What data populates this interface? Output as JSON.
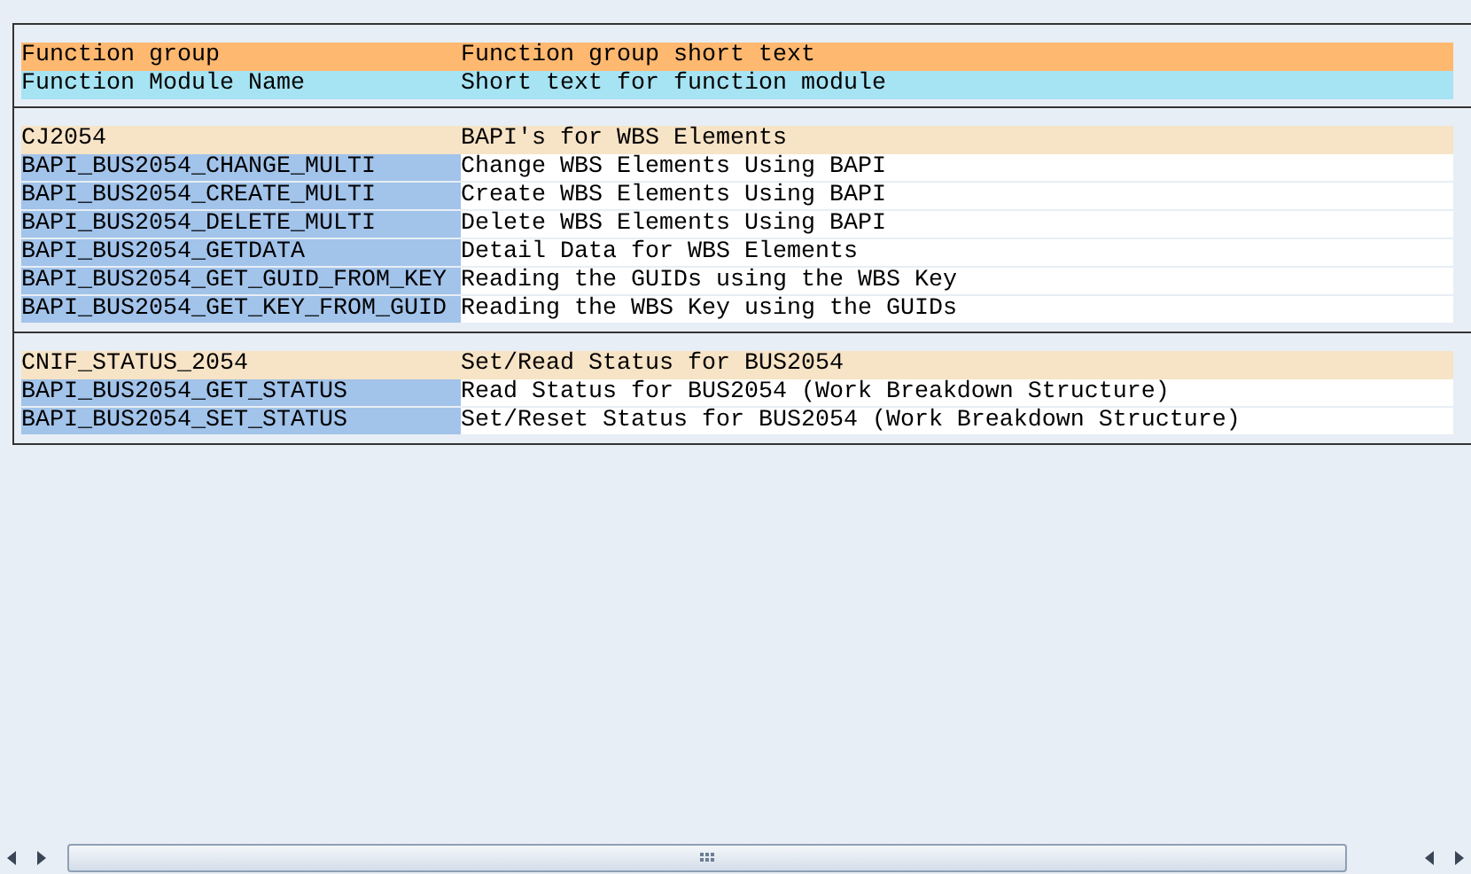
{
  "header": [
    {
      "kind": "group",
      "name": "Function group",
      "text": "Function group short text"
    },
    {
      "kind": "module",
      "name": "Function Module Name",
      "text": "Short text for function module"
    }
  ],
  "groups": [
    {
      "name": "CJ2054",
      "text": "BAPI's for WBS Elements",
      "modules": [
        {
          "name": "BAPI_BUS2054_CHANGE_MULTI",
          "text": "Change WBS Elements Using BAPI"
        },
        {
          "name": "BAPI_BUS2054_CREATE_MULTI",
          "text": "Create WBS Elements Using BAPI"
        },
        {
          "name": "BAPI_BUS2054_DELETE_MULTI",
          "text": "Delete WBS Elements Using BAPI"
        },
        {
          "name": "BAPI_BUS2054_GETDATA",
          "text": "Detail Data for WBS Elements"
        },
        {
          "name": "BAPI_BUS2054_GET_GUID_FROM_KEY",
          "text": "Reading the GUIDs using the WBS Key"
        },
        {
          "name": "BAPI_BUS2054_GET_KEY_FROM_GUID",
          "text": "Reading the WBS Key using the GUIDs"
        }
      ]
    },
    {
      "name": "CNIF_STATUS_2054",
      "text": "Set/Read Status for BUS2054",
      "modules": [
        {
          "name": "BAPI_BUS2054_GET_STATUS",
          "text": "Read Status for BUS2054 (Work Breakdown Structure)"
        },
        {
          "name": "BAPI_BUS2054_SET_STATUS",
          "text": "Set/Reset Status for BUS2054 (Work Breakdown Structure)"
        }
      ]
    }
  ]
}
